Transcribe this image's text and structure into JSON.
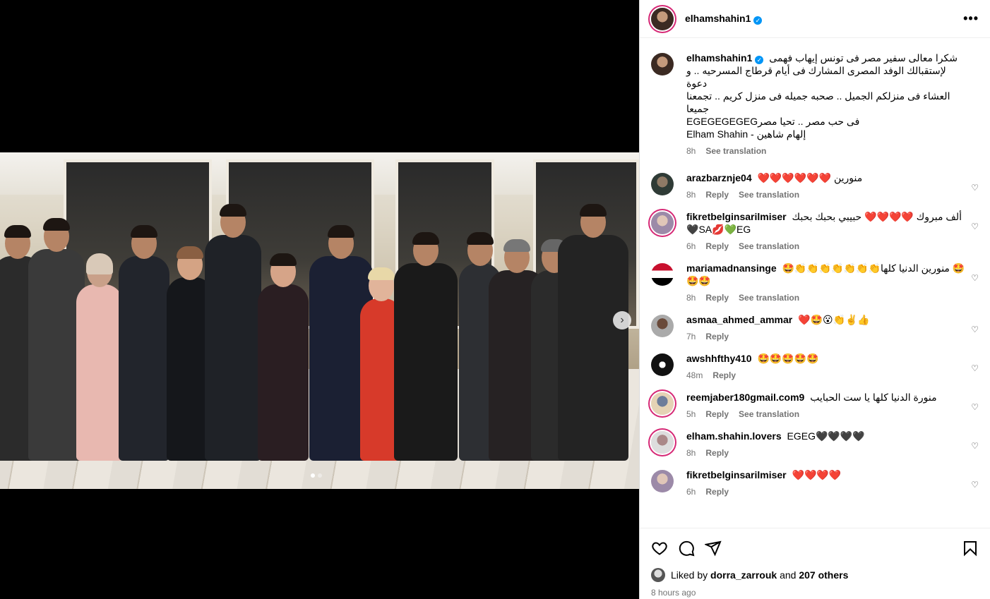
{
  "post": {
    "username": "elhamshahin1",
    "verified_mark": "✓",
    "more_label": "•••"
  },
  "caption": {
    "username": "elhamshahin1",
    "lines": [
      "شكرا معالى سفير مصر فى تونس إيهاب فهمى",
      "لإستقبالك الوفد المصرى المشارك فى أيام قرطاج المسرحيه .. و دعوة",
      "العشاء فى منزلكم الجميل .. صحبه جميله فى منزل كريم .. تجمعنا جميعا",
      "فى حب مصر .. تحيا مصرEGEGEGEGEG",
      "Elham Shahin - إلهام شاهين"
    ],
    "time": "8h",
    "translate": "See translation"
  },
  "comments": [
    {
      "username": "arazbarznje04",
      "text": "منورين ❤️❤️❤️❤️❤️❤️",
      "time": "8h",
      "reply": "Reply",
      "translate": "See translation"
    },
    {
      "username": "fikretbelginsarilmiser",
      "text": "ألف مبروك ❤️❤️❤️❤️ حبيبي بحبك بحبك SA💋💚EG🖤",
      "time": "6h",
      "reply": "Reply",
      "translate": "See translation"
    },
    {
      "username": "mariamadnansinge",
      "text": "🤩 منورين الدنيا كلها👏👏👏👏👏👏👏🤩🤩🤩",
      "time": "8h",
      "reply": "Reply",
      "translate": "See translation"
    },
    {
      "username": "asmaa_ahmed_ammar",
      "text": "❤️🤩😮👏✌️👍",
      "time": "7h",
      "reply": "Reply",
      "translate": ""
    },
    {
      "username": "awshhfthy410",
      "text": "🤩🤩🤩🤩🤩",
      "time": "48m",
      "reply": "Reply",
      "translate": ""
    },
    {
      "username": "reemjaber180gmail.com9",
      "text": "منورة الدنيا كلها يا ست الحبايب",
      "time": "5h",
      "reply": "Reply",
      "translate": "See translation"
    },
    {
      "username": "elham.shahin.lovers",
      "text": "EGEG🖤🖤🖤🖤",
      "time": "8h",
      "reply": "Reply",
      "translate": ""
    },
    {
      "username": "fikretbelginsarilmiser",
      "text": "❤️❤️❤️❤️",
      "time": "6h",
      "reply": "Reply",
      "translate": ""
    }
  ],
  "likes": {
    "prefix": "Liked by",
    "user": "dorra_zarrouk",
    "and": "and",
    "count": "207 others"
  },
  "timestamp": "8 hours ago",
  "media": {
    "next_arrow": "›",
    "slide_count": 2,
    "active_slide": 1
  },
  "colors": {
    "verified": "#0095f6",
    "meta_gray": "#737373",
    "story_ring": "#d62976"
  }
}
